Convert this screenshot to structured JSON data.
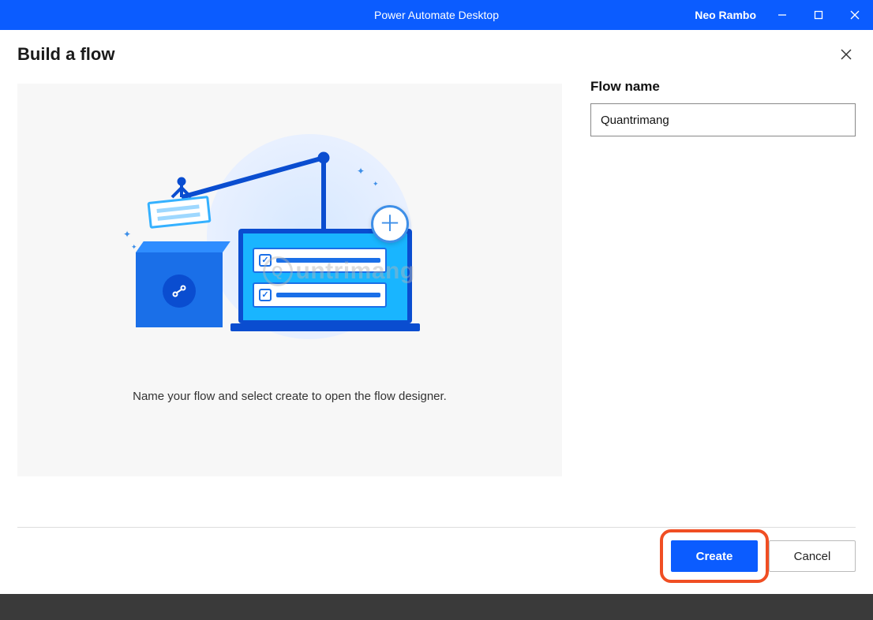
{
  "titlebar": {
    "app_title": "Power Automate Desktop",
    "user_name": "Neo Rambo"
  },
  "dialog": {
    "title": "Build a flow",
    "instruction": "Name your flow and select create to open the flow designer.",
    "watermark": "untrimang"
  },
  "form": {
    "flow_name_label": "Flow name",
    "flow_name_value": "Quantrimang"
  },
  "footer": {
    "create_label": "Create",
    "cancel_label": "Cancel"
  }
}
